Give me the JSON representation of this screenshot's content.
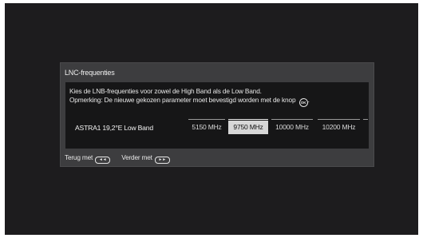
{
  "dialog": {
    "title": "LNC-frequenties",
    "description_line1": "Kies de LNB-frequenties voor zowel de High Band als de Low Band.",
    "description_line2": "Opmerking: De nieuwe gekozen parameter moet bevestigd worden met de knop",
    "ok_icon_symbol": "OK",
    "band_label": "ASTRA1 19,2°E Low Band",
    "frequencies": [
      "5150 MHz",
      "9750 MHz",
      "10000 MHz",
      "10200 MHz"
    ],
    "selected_index": 1
  },
  "footer": {
    "back_label": "Terug met",
    "back_key": "◄◄",
    "next_label": "Verder met",
    "next_key": "►►"
  },
  "colors": {
    "screen_bg": "#1d1c1e",
    "dialog_bg": "#3d3d3f",
    "inner_bg": "#161617",
    "selected_bg": "#d7d7d7"
  }
}
